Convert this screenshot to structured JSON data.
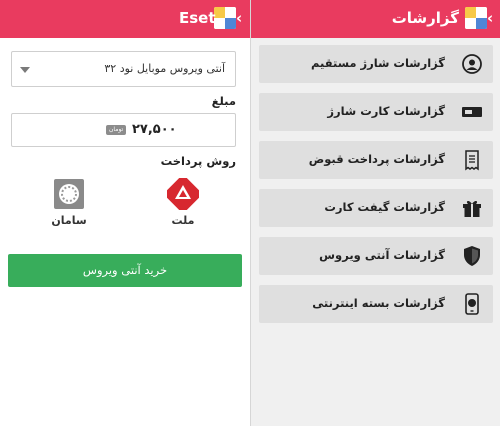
{
  "left": {
    "header_title": "Eset",
    "header_chevron": "‹",
    "product_select": "آنتی ویروس موبایل نود ۳۲",
    "amount_label": "مبلغ",
    "amount_value": "۲۷,۵۰۰",
    "amount_unit": "تومان",
    "payment_label": "روش پرداخت",
    "banks": [
      {
        "name": "ملت",
        "icon": "mellat-bank-logo"
      },
      {
        "name": "سامان",
        "icon": "saman-bank-logo"
      }
    ],
    "buy_button": "خرید آنتی ویروس"
  },
  "right": {
    "header_title": "گزارشات",
    "header_chevron": "‹",
    "reports": [
      {
        "label": "گزارشات شارژ مستقیم",
        "icon": "headset-icon"
      },
      {
        "label": "گزارشات کارت شارژ",
        "icon": "charge-card-icon"
      },
      {
        "label": "گزارشات پرداخت قبوض",
        "icon": "receipt-icon"
      },
      {
        "label": "گزارشات گیفت کارت",
        "icon": "gift-icon"
      },
      {
        "label": "گزارشات آنتی ویروس",
        "icon": "shield-icon"
      },
      {
        "label": "گزارشات بسته اینترنتی",
        "icon": "mobile-globe-icon"
      }
    ]
  },
  "colors": {
    "header": "#e93b5f",
    "buy_button": "#38ad5b",
    "report_item_bg": "#dfdfdf",
    "right_bg": "#f0f0f0"
  }
}
